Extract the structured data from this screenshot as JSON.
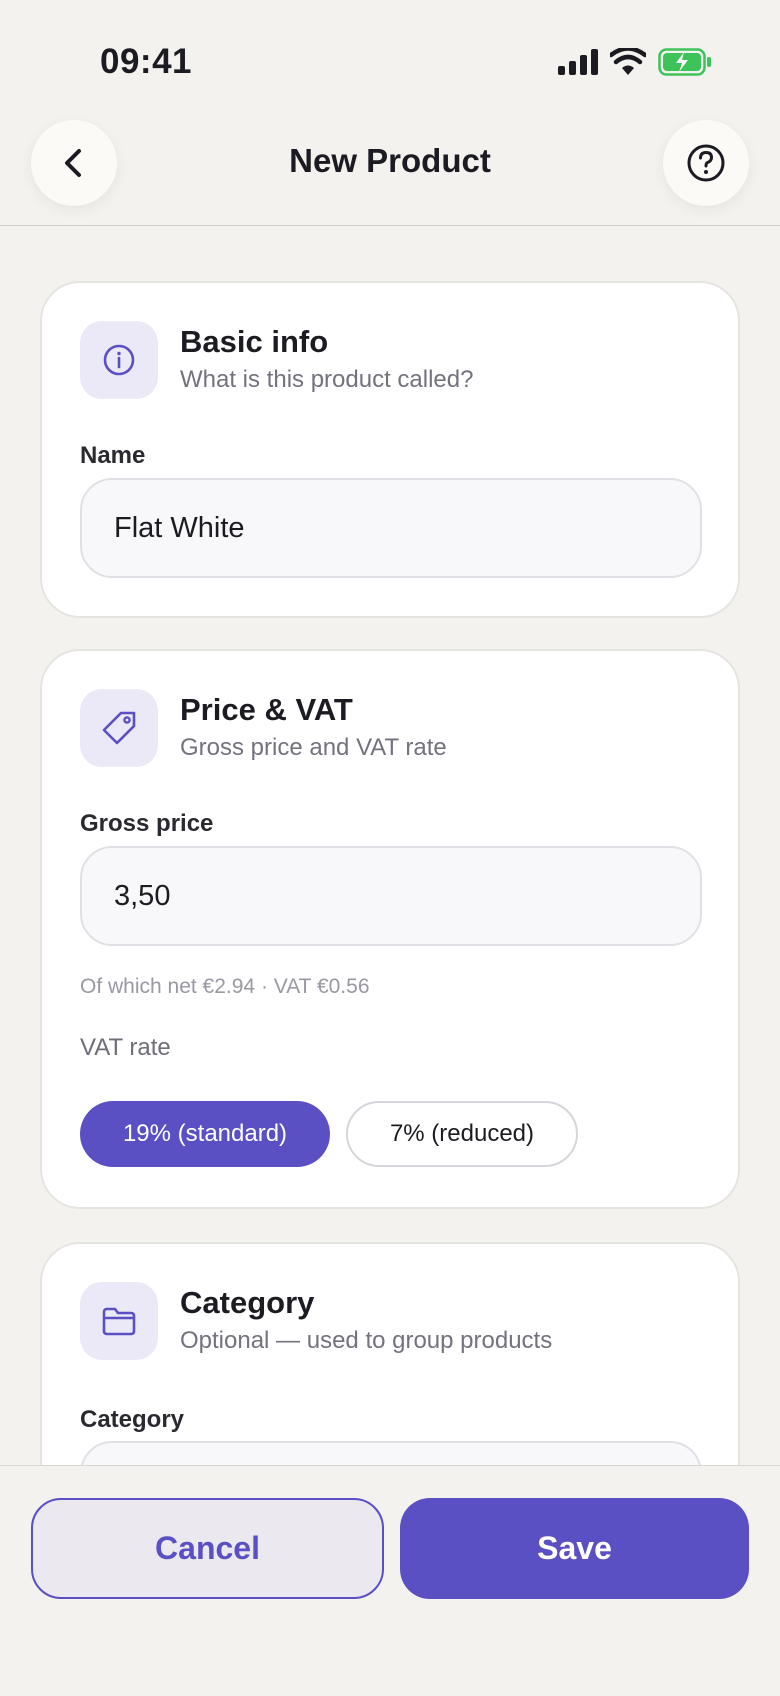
{
  "status_bar": {
    "time": "09:41"
  },
  "nav": {
    "title": "New Product"
  },
  "basic_info": {
    "title": "Basic info",
    "subtitle": "What is this product called?",
    "name_label": "Name",
    "name_value": "Flat White"
  },
  "price": {
    "title": "Price & VAT",
    "subtitle": "Gross price and VAT rate",
    "gross_label": "Gross price",
    "gross_value": "3,50",
    "hint": "Of which net €2.94 · VAT €0.56",
    "vat_label": "VAT rate",
    "vat_options": [
      "19% (standard)",
      "7% (reduced)"
    ],
    "vat_selected": "19% (standard)"
  },
  "category": {
    "title": "Category",
    "subtitle": "Optional — used to group products",
    "field_label": "Category"
  },
  "footer": {
    "cancel_label": "Cancel",
    "save_label": "Save"
  },
  "colors": {
    "accent": "#5b4fc4",
    "background": "#f3f2ef",
    "icon_tile": "#ebe8f7",
    "battery": "#3ec25a"
  }
}
